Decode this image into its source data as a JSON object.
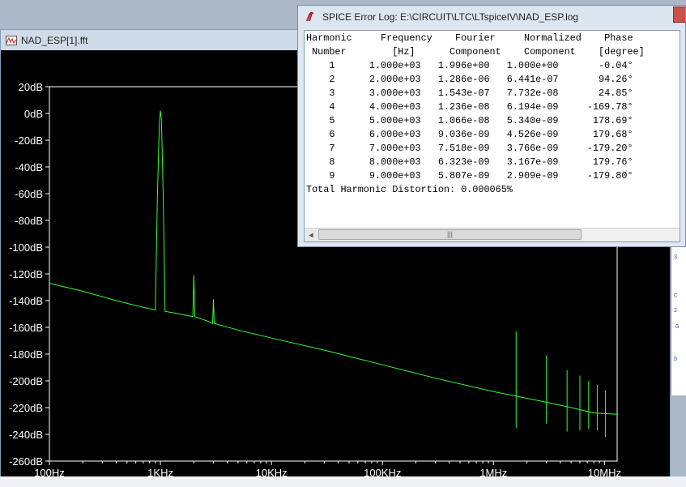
{
  "plot_window": {
    "title": "NAD_ESP[1].fft",
    "icon": "fft-waveform-icon"
  },
  "log_window": {
    "title": "SPICE Error Log: E:\\CIRCUIT\\LTC\\LTspiceIV\\NAD_ESP.log",
    "icon": "ltspice-logo-icon",
    "scroll_thumb_grip": "|||",
    "scroll_left_arrow": "◄",
    "lines": [
      "Harmonic     Frequency    Fourier     Normalized    Phase",
      " Number        [Hz]      Component    Component    [degree]",
      "    1      1.000e+03   1.996e+00   1.000e+00       -0.04°",
      "    2      2.000e+03   1.286e-06   6.441e-07       94.26°",
      "    3      3.000e+03   1.543e-07   7.732e-08       24.85°",
      "    4      4.000e+03   1.236e-08   6.194e-09     -169.78°",
      "    5      5.000e+03   1.066e-08   5.340e-09      178.69°",
      "    6      6.000e+03   9.036e-09   4.526e-09      179.68°",
      "    7      7.000e+03   7.518e-09   3.766e-09     -179.20°",
      "    8      8.000e+03   6.323e-09   3.167e-09      179.76°",
      "    9      9.000e+03   5.807e-09   2.909e-09     -179.80°",
      "Total Harmonic Distortion: 0.000065%"
    ]
  },
  "colors": {
    "plot_background": "#000000",
    "trace": "#33ff33",
    "axis": "#ffffff",
    "tick_text": "#ffffff"
  },
  "chart_data": {
    "type": "line",
    "xscale": "log",
    "xlim": [
      100,
      13000000
    ],
    "ylim": [
      -260,
      20
    ],
    "xticks": [
      {
        "label": "100Hz",
        "value": 100
      },
      {
        "label": "1KHz",
        "value": 1000
      },
      {
        "label": "10KHz",
        "value": 10000
      },
      {
        "label": "100KHz",
        "value": 100000
      },
      {
        "label": "1MHz",
        "value": 1000000
      },
      {
        "label": "10MHz",
        "value": 10000000
      }
    ],
    "yticks": [
      {
        "label": "20dB",
        "value": 20
      },
      {
        "label": "0dB",
        "value": 0
      },
      {
        "label": "-20dB",
        "value": -20
      },
      {
        "label": "-40dB",
        "value": -40
      },
      {
        "label": "-60dB",
        "value": -60
      },
      {
        "label": "-80dB",
        "value": -80
      },
      {
        "label": "-100dB",
        "value": -100
      },
      {
        "label": "-120dB",
        "value": -120
      },
      {
        "label": "-140dB",
        "value": -140
      },
      {
        "label": "-160dB",
        "value": -160
      },
      {
        "label": "-180dB",
        "value": -180
      },
      {
        "label": "-200dB",
        "value": -200
      },
      {
        "label": "-220dB",
        "value": -220
      },
      {
        "label": "-240dB",
        "value": -240
      },
      {
        "label": "-260dB",
        "value": -260
      }
    ],
    "series": [
      {
        "x": [
          100,
          200,
          400,
          700,
          900,
          940,
          980,
          1000,
          1020,
          1060,
          1100,
          1500,
          1960,
          2000,
          2040,
          2600,
          2950,
          3000,
          3050,
          5000,
          10000,
          30000,
          100000,
          300000,
          1000000,
          3000000,
          5000000,
          8000000,
          13000000
        ],
        "y": [
          -127,
          -133,
          -140,
          -145,
          -147,
          -60,
          -5,
          2,
          -5,
          -60,
          -148,
          -150,
          -152,
          -121,
          -152,
          -155,
          -157,
          -139,
          -157,
          -162,
          -168,
          -177,
          -188,
          -198,
          -208,
          -216,
          -220,
          -224,
          -225
        ]
      }
    ],
    "spurs": [
      {
        "x": 1600000,
        "top": -163,
        "bottom": -235
      },
      {
        "x": 3000000,
        "top": -181,
        "bottom": -232
      },
      {
        "x": 4600000,
        "top": -192,
        "bottom": -238
      },
      {
        "x": 6000000,
        "top": -196,
        "bottom": -237
      },
      {
        "x": 7200000,
        "top": -200,
        "bottom": -236
      },
      {
        "x": 8600000,
        "top": -203,
        "bottom": -237
      },
      {
        "x": 10200000,
        "top": -207,
        "bottom": -242
      }
    ]
  }
}
